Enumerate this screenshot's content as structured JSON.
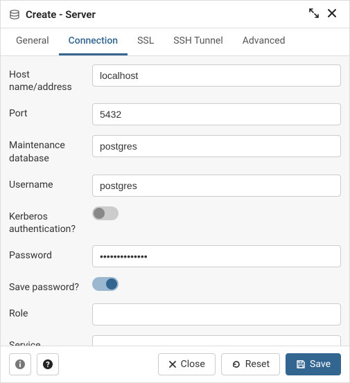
{
  "titlebar": {
    "title": "Create - Server"
  },
  "tabs": [
    {
      "label": "General"
    },
    {
      "label": "Connection"
    },
    {
      "label": "SSL"
    },
    {
      "label": "SSH Tunnel"
    },
    {
      "label": "Advanced"
    }
  ],
  "fields": {
    "host": {
      "label": "Host name/address",
      "value": "localhost"
    },
    "port": {
      "label": "Port",
      "value": "5432"
    },
    "maintdb": {
      "label": "Maintenance database",
      "value": "postgres"
    },
    "username": {
      "label": "Username",
      "value": "postgres"
    },
    "kerberos": {
      "label": "Kerberos authentication?"
    },
    "password": {
      "label": "Password",
      "value": "••••••••••••••"
    },
    "savepw": {
      "label": "Save password?"
    },
    "role": {
      "label": "Role",
      "value": ""
    },
    "service": {
      "label": "Service",
      "value": ""
    }
  },
  "footer": {
    "close": "Close",
    "reset": "Reset",
    "save": "Save"
  }
}
